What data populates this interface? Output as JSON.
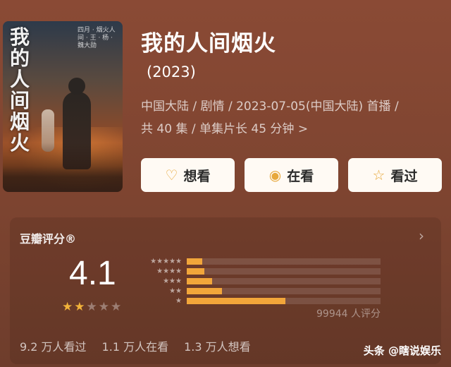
{
  "poster": {
    "title": "我的人间烟火",
    "side_text": "四月 · 烟火人间 · 王 · 杨 · 魏大勋"
  },
  "show": {
    "title": "我的人间烟火",
    "year": "(2023)",
    "meta_line1": "中国大陆 / 剧情 / 2023-07-05(中国大陆) 首播 /",
    "meta_line2": "共 40 集 / 单集片长 45 分钟 >"
  },
  "actions": {
    "want_label": "想看",
    "watching_label": "在看",
    "seen_label": "看过",
    "want_icon": "heart-plus-icon",
    "watching_icon": "circle-dot-icon",
    "seen_icon": "star-outline-icon"
  },
  "rating": {
    "label": "豆瓣评分®",
    "score": "4.1",
    "stars_filled": 2,
    "stars_total": 5,
    "distribution": [
      {
        "stars": "★★★★★",
        "fraction": 0.08
      },
      {
        "stars": "★★★★",
        "fraction": 0.09
      },
      {
        "stars": "★★★",
        "fraction": 0.13
      },
      {
        "stars": "★★",
        "fraction": 0.18
      },
      {
        "stars": "★",
        "fraction": 0.51
      }
    ],
    "count_text": "99944 人评分"
  },
  "stats": {
    "seen": "9.2 万人看过",
    "watching": "1.1 万人在看",
    "want": "1.3 万人想看"
  },
  "watermark": "头条 @瞎说娱乐",
  "colors": {
    "accent": "#f2a63a",
    "background": "#7d4430",
    "button_bg": "#fffaf4"
  }
}
